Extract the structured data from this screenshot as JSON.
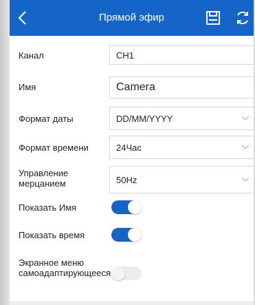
{
  "colors": {
    "appbar": "#1565c9",
    "toggle_on": "#1565c9",
    "toggle_off": "#ececec"
  },
  "header": {
    "title": "Прямой эфир",
    "back_icon": "chevron-left-icon",
    "save_icon": "save-icon",
    "refresh_icon": "refresh-icon"
  },
  "form": {
    "channel": {
      "label": "Канал",
      "value": "CH1"
    },
    "name": {
      "label": "Имя",
      "value": "Camera"
    },
    "date_format": {
      "label": "Формат даты",
      "value": "DD/MM/YYYY"
    },
    "time_format": {
      "label": "Формат времени",
      "value": "24Час"
    },
    "flicker": {
      "label": "Управление мерцанием",
      "value": "50Hz"
    },
    "show_name": {
      "label": "Показать Имя",
      "on": true
    },
    "show_time": {
      "label": "Показать время",
      "on": true
    },
    "osd_adaptive": {
      "label": "Экранное меню самоадаптирующееся",
      "on": false
    }
  }
}
